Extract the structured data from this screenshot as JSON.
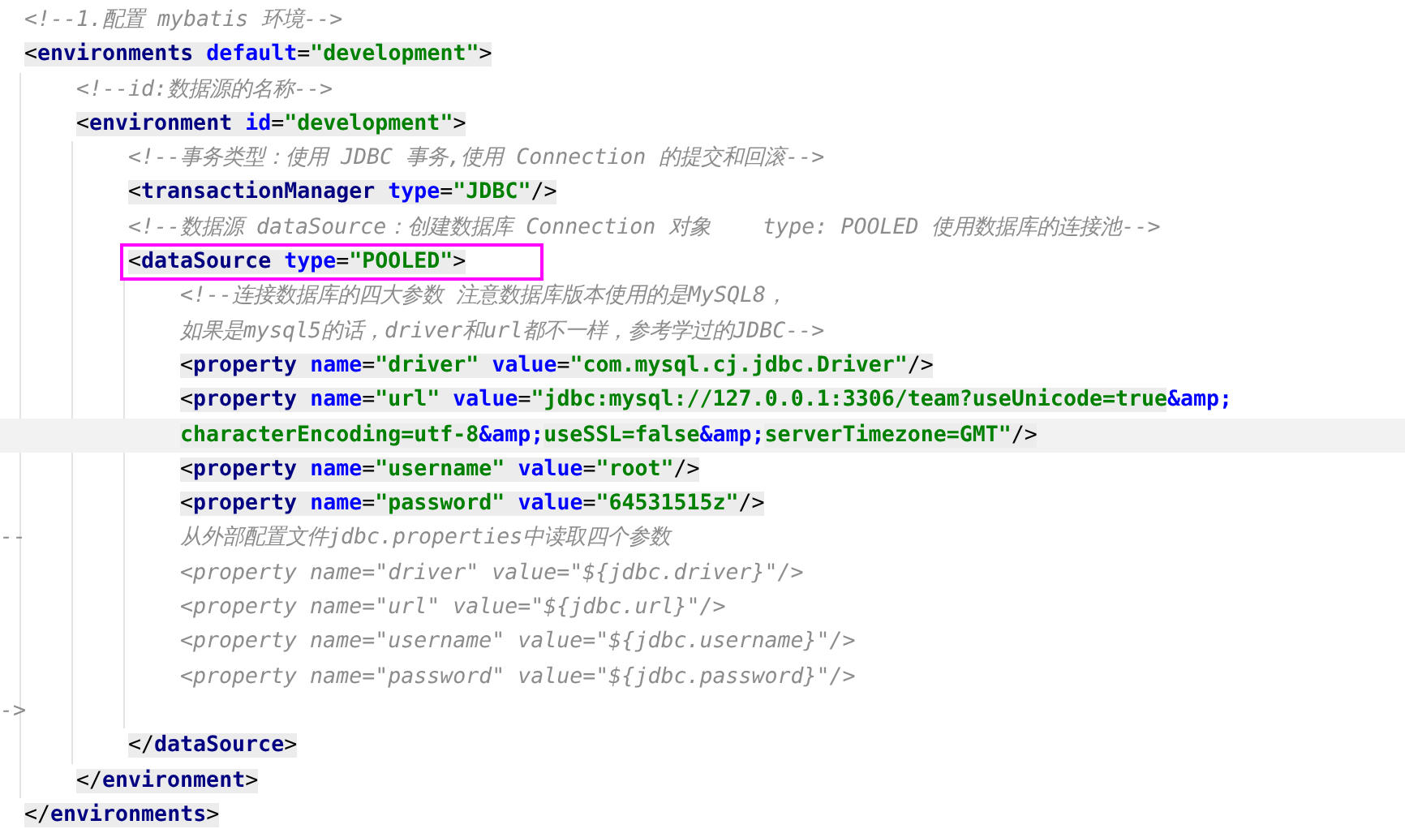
{
  "editor": {
    "lines": [
      {
        "tokens": [
          {
            "kind": "comment",
            "text": "<!--1.配置 mybatis 环境-->"
          }
        ]
      },
      {
        "highlighted": true,
        "tokens": [
          {
            "kind": "bracket",
            "text": "<"
          },
          {
            "kind": "tag",
            "text": "environments "
          },
          {
            "kind": "attr",
            "text": "default"
          },
          {
            "kind": "bracket",
            "text": "="
          },
          {
            "kind": "value",
            "text": "\"development\""
          },
          {
            "kind": "bracket",
            "text": ">"
          }
        ],
        "children": [
          {
            "tokens": [
              {
                "kind": "comment",
                "text": "<!--id:数据源的名称-->"
              }
            ]
          },
          {
            "highlighted": true,
            "tokens": [
              {
                "kind": "bracket",
                "text": "<"
              },
              {
                "kind": "tag",
                "text": "environment "
              },
              {
                "kind": "attr",
                "text": "id"
              },
              {
                "kind": "bracket",
                "text": "="
              },
              {
                "kind": "value",
                "text": "\"development\""
              },
              {
                "kind": "bracket",
                "text": ">"
              }
            ],
            "children": [
              {
                "tokens": [
                  {
                    "kind": "comment",
                    "text": "<!--事务类型：使用 JDBC 事务,使用 Connection 的提交和回滚-->"
                  }
                ]
              },
              {
                "highlighted": true,
                "tokens": [
                  {
                    "kind": "bracket",
                    "text": "<"
                  },
                  {
                    "kind": "tag",
                    "text": "transactionManager "
                  },
                  {
                    "kind": "attr",
                    "text": "type"
                  },
                  {
                    "kind": "bracket",
                    "text": "="
                  },
                  {
                    "kind": "value",
                    "text": "\"JDBC\""
                  },
                  {
                    "kind": "bracket",
                    "text": "/>"
                  }
                ]
              },
              {
                "tokens": [
                  {
                    "kind": "comment",
                    "text": "<!--数据源 dataSource：创建数据库 Connection 对象    type: POOLED 使用数据库的连接池-->"
                  }
                ]
              },
              {
                "highlighted": true,
                "boxed": true,
                "tokens": [
                  {
                    "kind": "bracket",
                    "text": "<"
                  },
                  {
                    "kind": "tag",
                    "text": "dataSource "
                  },
                  {
                    "kind": "attr",
                    "text": "type"
                  },
                  {
                    "kind": "bracket",
                    "text": "="
                  },
                  {
                    "kind": "value",
                    "text": "\"POOLED\""
                  },
                  {
                    "kind": "bracket",
                    "text": ">"
                  }
                ],
                "children": [
                  {
                    "tokens": [
                      {
                        "kind": "comment",
                        "text": "<!--连接数据库的四大参数 注意数据库版本使用的是MySQL8，"
                      }
                    ]
                  },
                  {
                    "tokens": [
                      {
                        "kind": "comment",
                        "text": "如果是mysql5的话，driver和url都不一样，参考学过的JDBC-->"
                      }
                    ]
                  },
                  {
                    "highlighted": true,
                    "tokens": [
                      {
                        "kind": "bracket",
                        "text": "<"
                      },
                      {
                        "kind": "tag",
                        "text": "property "
                      },
                      {
                        "kind": "attr",
                        "text": "name"
                      },
                      {
                        "kind": "bracket",
                        "text": "="
                      },
                      {
                        "kind": "value",
                        "text": "\"driver\" "
                      },
                      {
                        "kind": "attr",
                        "text": "value"
                      },
                      {
                        "kind": "bracket",
                        "text": "="
                      },
                      {
                        "kind": "value",
                        "text": "\"com.mysql.cj.jdbc.Driver\""
                      },
                      {
                        "kind": "bracket",
                        "text": "/>"
                      }
                    ]
                  },
                  {
                    "highlighted": true,
                    "tokens": [
                      {
                        "kind": "bracket",
                        "text": "<"
                      },
                      {
                        "kind": "tag",
                        "text": "property "
                      },
                      {
                        "kind": "attr",
                        "text": "name"
                      },
                      {
                        "kind": "bracket",
                        "text": "="
                      },
                      {
                        "kind": "value",
                        "text": "\"url\" "
                      },
                      {
                        "kind": "attr",
                        "text": "value"
                      },
                      {
                        "kind": "bracket",
                        "text": "="
                      },
                      {
                        "kind": "value",
                        "text": "\"jdbc:mysql://127.0.0.1:3306/team?useUnicode=true"
                      },
                      {
                        "kind": "entity",
                        "text": "&amp;"
                      }
                    ]
                  },
                  {
                    "highlighted": true,
                    "current": true,
                    "tokens": [
                      {
                        "kind": "value",
                        "text": "characterEncoding=utf-8"
                      },
                      {
                        "kind": "entity",
                        "text": "&amp;"
                      },
                      {
                        "kind": "value",
                        "text": "useSSL=false"
                      },
                      {
                        "kind": "entity",
                        "text": "&amp;"
                      },
                      {
                        "kind": "value",
                        "text": "serverTimezone=GMT\""
                      },
                      {
                        "kind": "bracket",
                        "text": "/>"
                      }
                    ]
                  },
                  {
                    "highlighted": true,
                    "tokens": [
                      {
                        "kind": "bracket",
                        "text": "<"
                      },
                      {
                        "kind": "tag",
                        "text": "property "
                      },
                      {
                        "kind": "attr",
                        "text": "name"
                      },
                      {
                        "kind": "bracket",
                        "text": "="
                      },
                      {
                        "kind": "value",
                        "text": "\"username\" "
                      },
                      {
                        "kind": "attr",
                        "text": "value"
                      },
                      {
                        "kind": "bracket",
                        "text": "="
                      },
                      {
                        "kind": "value",
                        "text": "\"root\""
                      },
                      {
                        "kind": "bracket",
                        "text": "/>"
                      }
                    ]
                  },
                  {
                    "highlighted": true,
                    "tokens": [
                      {
                        "kind": "bracket",
                        "text": "<"
                      },
                      {
                        "kind": "tag",
                        "text": "property "
                      },
                      {
                        "kind": "attr",
                        "text": "name"
                      },
                      {
                        "kind": "bracket",
                        "text": "="
                      },
                      {
                        "kind": "value",
                        "text": "\"password\" "
                      },
                      {
                        "kind": "attr",
                        "text": "value"
                      },
                      {
                        "kind": "bracket",
                        "text": "="
                      },
                      {
                        "kind": "value",
                        "text": "\"64531515z\""
                      },
                      {
                        "kind": "bracket",
                        "text": "/>"
                      }
                    ]
                  },
                  {
                    "margin_text": "--",
                    "tokens": [
                      {
                        "kind": "comment",
                        "text": "从外部配置文件jdbc.properties中读取四个参数"
                      }
                    ]
                  },
                  {
                    "tokens": [
                      {
                        "kind": "comment",
                        "text": "<property name=\"driver\" value=\"${jdbc.driver}\"/>"
                      }
                    ]
                  },
                  {
                    "tokens": [
                      {
                        "kind": "comment",
                        "text": "<property name=\"url\" value=\"${jdbc.url}\"/>"
                      }
                    ]
                  },
                  {
                    "tokens": [
                      {
                        "kind": "comment",
                        "text": "<property name=\"username\" value=\"${jdbc.username}\"/>"
                      }
                    ]
                  },
                  {
                    "tokens": [
                      {
                        "kind": "comment",
                        "text": "<property name=\"password\" value=\"${jdbc.password}\"/>"
                      }
                    ]
                  },
                  {
                    "margin_text": "->"
                  }
                ]
              },
              {
                "highlighted": true,
                "tokens": [
                  {
                    "kind": "bracket",
                    "text": "</"
                  },
                  {
                    "kind": "tag",
                    "text": "dataSource"
                  },
                  {
                    "kind": "bracket",
                    "text": ">"
                  }
                ]
              }
            ]
          },
          {
            "highlighted": true,
            "tokens": [
              {
                "kind": "bracket",
                "text": "</"
              },
              {
                "kind": "tag",
                "text": "environment"
              },
              {
                "kind": "bracket",
                "text": ">"
              }
            ]
          }
        ]
      },
      {
        "highlighted": true,
        "tokens": [
          {
            "kind": "bracket",
            "text": "</"
          },
          {
            "kind": "tag",
            "text": "environments"
          },
          {
            "kind": "bracket",
            "text": ">"
          }
        ]
      }
    ]
  }
}
